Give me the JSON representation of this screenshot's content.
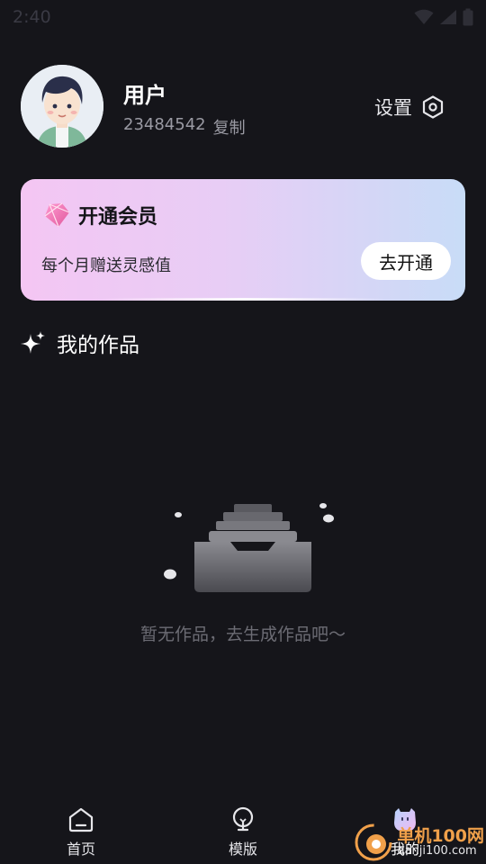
{
  "status_bar": {
    "time": "2:40"
  },
  "profile": {
    "name": "用户",
    "user_id": "23484542",
    "copy_label": "复制",
    "settings_label": "设置"
  },
  "vip_card": {
    "title": "开通会员",
    "subtitle": "每个月赠送灵感值",
    "button_label": "去开通"
  },
  "works": {
    "section_title": "我的作品",
    "empty_text": "暂无作品，去生成作品吧～"
  },
  "bottom_nav": {
    "items": [
      {
        "label": "首页",
        "icon": "home-icon"
      },
      {
        "label": "模版",
        "icon": "bulb-icon"
      },
      {
        "label": "我的",
        "icon": "mascot-avatar-icon"
      }
    ],
    "active_index": 2
  },
  "watermark": {
    "main": "单机100网",
    "url": "danji100.com"
  },
  "colors": {
    "background": "#15151a",
    "vip_gradient_start": "#f4c6f3",
    "vip_gradient_end": "#c8dcf7",
    "muted_text": "#9a9aa3",
    "watermark_orange": "#f0a04a"
  }
}
